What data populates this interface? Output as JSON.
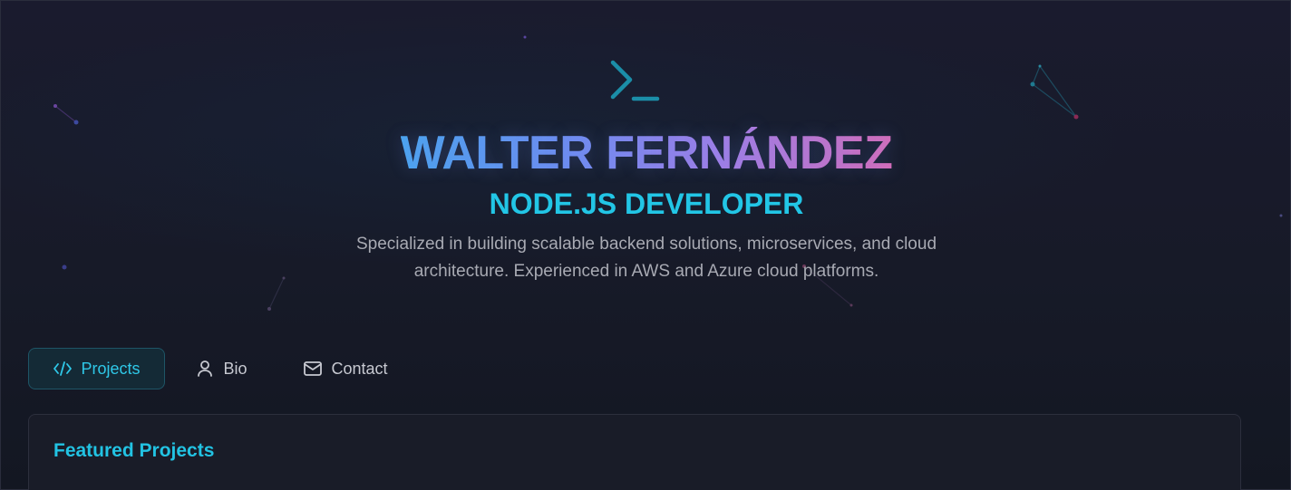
{
  "hero": {
    "name": "WALTER FERNÁNDEZ",
    "role": "NODE.JS DEVELOPER",
    "bio_line1": "Specialized in building scalable backend solutions, microservices, and cloud",
    "bio_line2": "architecture. Experienced in AWS and Azure cloud platforms.",
    "icon": "terminal-icon"
  },
  "tabs": [
    {
      "label": "Projects",
      "icon": "code-icon",
      "active": true
    },
    {
      "label": "Bio",
      "icon": "user-icon",
      "active": false
    },
    {
      "label": "Contact",
      "icon": "mail-icon",
      "active": false
    }
  ],
  "section": {
    "title": "Featured Projects"
  },
  "colors": {
    "accent": "#22c6e6",
    "name_gradient_start": "#4aa5ef",
    "name_gradient_end": "#d76cb8",
    "background": "#171a28"
  }
}
